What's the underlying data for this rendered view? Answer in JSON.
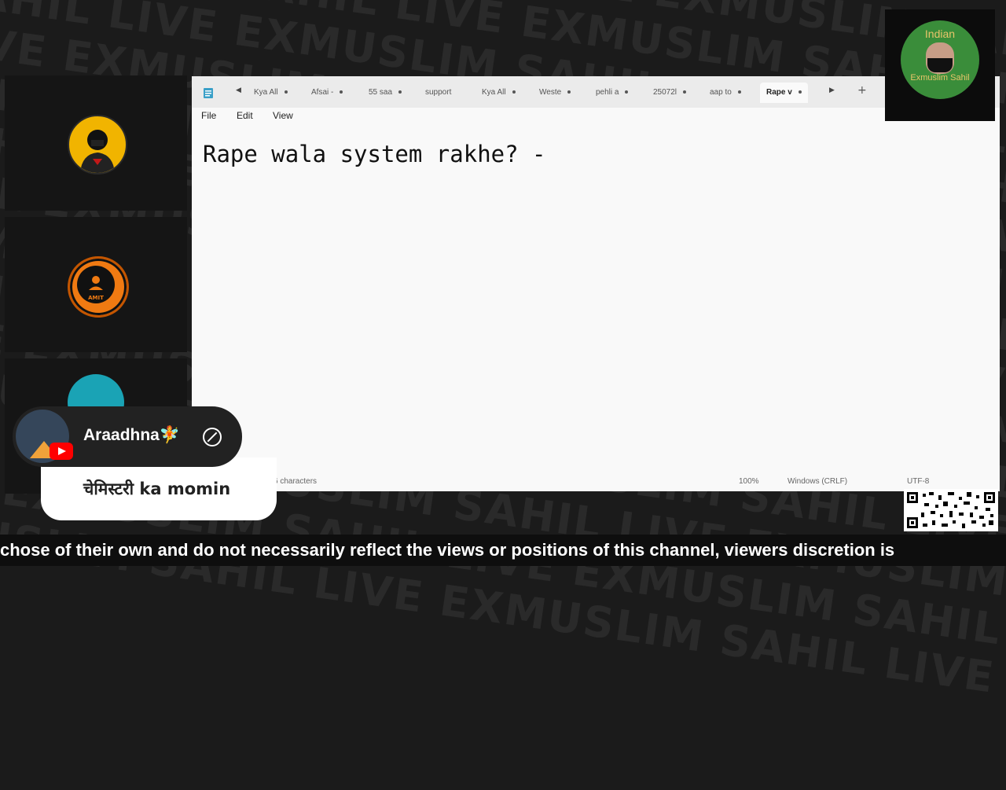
{
  "watermark": {
    "lines": [
      "LIVE EXMUSLIM SAHIL LIVE EXMUSLIM SAHIL LIVE EXMUSLIM",
      "EXMUSLIM SAHIL LIVE EXMUSLIM SAHIL LIVE EXMUSLIM SAHIL",
      "SAHIL LIVE EXMUSLIM SAHIL LIVE EXMUSLIM SAHIL LIVE",
      "LIVE EXMUSLIM SAHIL LIVE EXMUSLIM SAHIL LIVE EXMUSLIM",
      "EXMUSLIM SAHIL LIVE EXMUSLIM SAHIL LIVE EXMUSLIM SAHIL",
      "SAHIL LIVE EXMUSLIM SAHIL LIVE EXMUSLIM SAHIL LIVE",
      "LIVE EXMUSLIM SAHIL LIVE EXMUSLIM SAHIL LIVE EXMUSLIM",
      "EXMUSLIM SAHIL LIVE EXMUSLIM SAHIL LIVE EXMUSLIM SAHIL",
      "SAHIL LIVE EXMUSLIM SAHIL LIVE EXMUSLIM SAHIL LIVE",
      "LIVE EXMUSLIM SAHIL LIVE EXMUSLIM SAHIL LIVE EXMUSLIM",
      "EXMUSLIM SAHIL LIVE EXMUSLIM SAHIL LIVE EXMUSLIM SAHIL",
      "SAHIL LIVE EXMUSLIM SAHIL LIVE EXMUSLIM SAHIL LIVE",
      "LIVE EXMUSLIM SAHIL LIVE EXMUSLIM SAHIL LIVE EXMUSLIM",
      "EXMUSLIM SAHIL LIVE EXMUSLIM SAHIL LIVE EXMUSLIM SAHIL"
    ]
  },
  "participants": {
    "slot2_badge": "AMIT"
  },
  "notepad": {
    "tabs": [
      "Kya All",
      "Afsai -",
      "55 saa",
      "support",
      "Kya All",
      "Weste",
      "pehli a",
      "25072l",
      "aap to",
      "Rape v"
    ],
    "menu": {
      "file": "File",
      "edit": "Edit",
      "view": "View"
    },
    "editor_text": "Rape wala system rakhe? -",
    "status": {
      "chars": "6 characters",
      "zoom": "100%",
      "eol": "Windows (CRLF)",
      "encoding": "UTF-8"
    }
  },
  "webcam": {
    "top_text": "Indian",
    "bottom_text": "Exmuslim Sahil"
  },
  "chat": {
    "name": "Araadhna🧚",
    "message": "चेमिस्टरी ka momin"
  },
  "ticker": {
    "text": "chose of their own and do not necessarily reflect the views or positions of this channel, viewers discretion is"
  },
  "colors": {
    "accent_orange": "#f07a12",
    "yt_red": "#ff0000",
    "notepad_bg": "#f9f9f9"
  }
}
